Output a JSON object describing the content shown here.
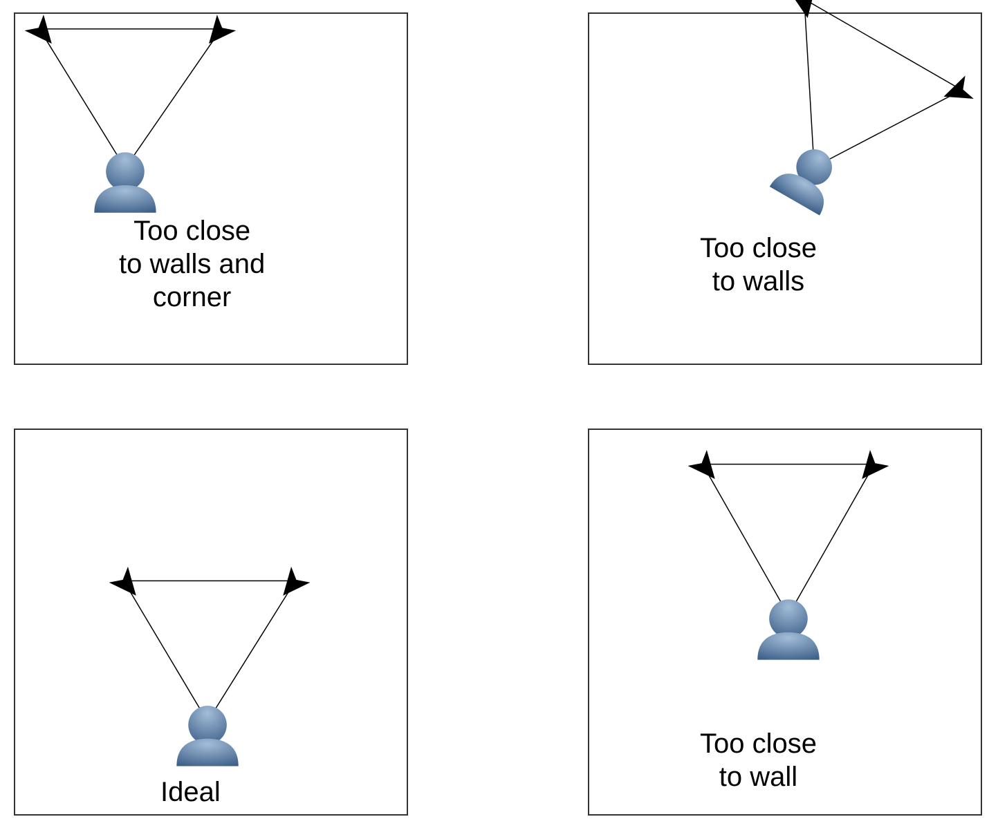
{
  "panels": {
    "top_left": {
      "caption": "Too close\nto walls and\ncorner"
    },
    "top_right": {
      "caption": "Too close\nto walls"
    },
    "bottom_left": {
      "caption": "Ideal"
    },
    "bottom_right": {
      "caption": "Too close\nto wall"
    }
  },
  "colors": {
    "person_top": "#a3bdd8",
    "person_bottom": "#3c5e87",
    "speaker": "#000000",
    "line": "#000000",
    "border": "#333333"
  }
}
